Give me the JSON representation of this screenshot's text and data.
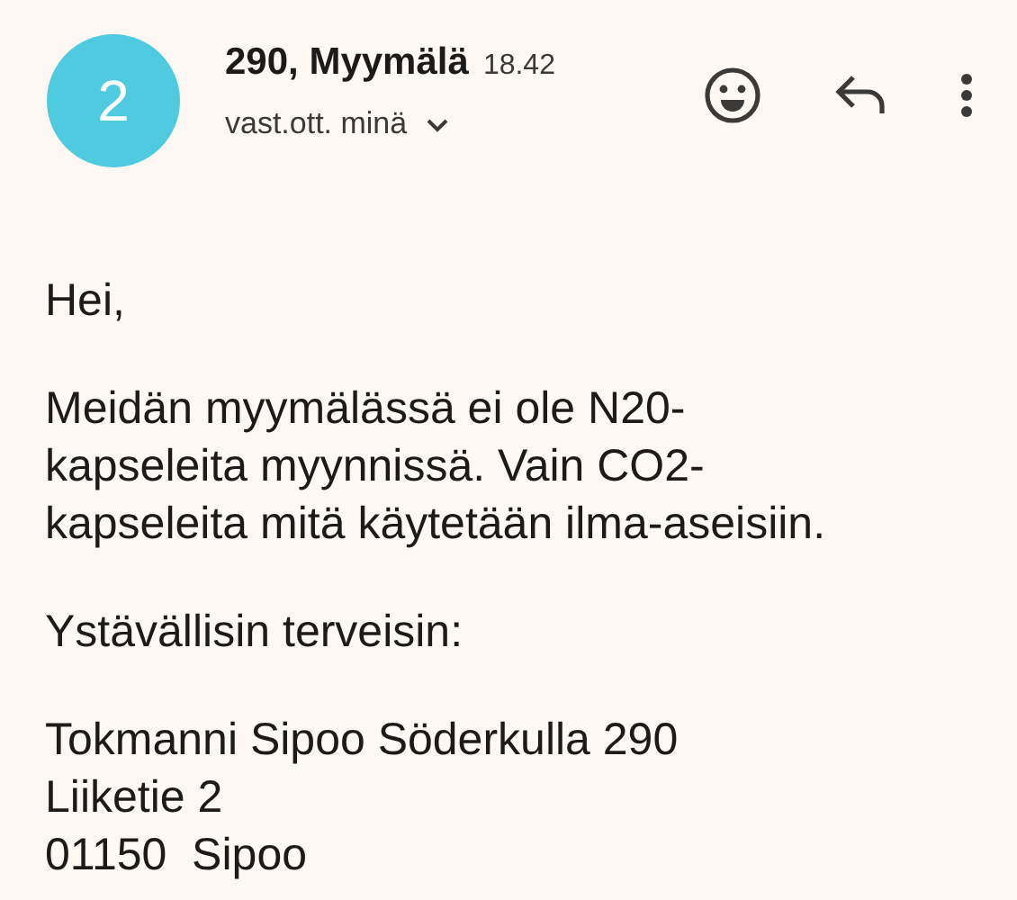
{
  "message": {
    "avatar": {
      "initial": "2",
      "color": "#4fcbe0"
    },
    "sender": "290, Myymälä",
    "time": "18.42",
    "recipient": "vast.ott. minä",
    "body": [
      {
        "lines": [
          "Hei,"
        ]
      },
      {
        "lines": [
          "Meidän myymälässä ei ole N20-",
          "kapseleita myynnissä. Vain CO2-",
          "kapseleita mitä käytetään ilma-aseisiin."
        ]
      },
      {
        "lines": [
          "Ystävällisin terveisin:"
        ]
      },
      {
        "lines": [
          "Tokmanni Sipoo Söderkulla 290",
          "Liiketie 2",
          "01150  Sipoo"
        ]
      }
    ]
  }
}
